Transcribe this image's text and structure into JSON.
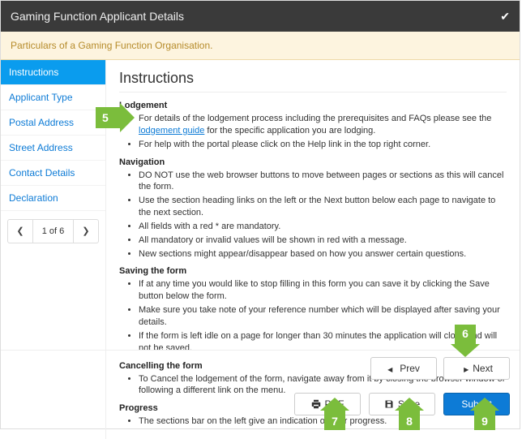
{
  "header": {
    "title": "Gaming Function Applicant Details"
  },
  "notice": "Particulars of a Gaming Function Organisation.",
  "sidebar": {
    "items": [
      "Instructions",
      "Applicant Type",
      "Postal Address",
      "Street Address",
      "Contact Details",
      "Declaration"
    ],
    "active_index": 0,
    "pager": "1 of 6"
  },
  "main": {
    "title": "Instructions",
    "sections": [
      {
        "heading": "Lodgement",
        "items": [
          {
            "pre": "For details of the lodgement process including the prerequisites and FAQs please see the ",
            "link": "lodgement guide",
            "post": " for the specific application you are lodging."
          },
          {
            "text": "For help with the portal please click on the Help link in the top right corner."
          }
        ]
      },
      {
        "heading": "Navigation",
        "items": [
          {
            "text": "DO NOT use the web browser buttons to move between pages or sections as this will cancel the form."
          },
          {
            "text": "Use the section heading links on the left or the Next button below each page to navigate to the next section."
          },
          {
            "text": "All fields with a red * are mandatory."
          },
          {
            "text": "All mandatory or invalid values will be shown in red with a message."
          },
          {
            "text": "New sections might appear/disappear based on how you answer certain questions."
          }
        ]
      },
      {
        "heading": "Saving the form",
        "items": [
          {
            "text": "If at any time you would like to stop filling in this form you can save it by clicking the Save button below the form."
          },
          {
            "text": "Make sure you take note of your reference number which will be displayed after saving your details."
          },
          {
            "text": "If the form is left idle on a page for longer than 30 minutes the application will close and will not be saved."
          }
        ]
      },
      {
        "heading": "Cancelling the form",
        "items": [
          {
            "text": "To Cancel the lodgement of the form, navigate away from it by closing the browser window or following a different link on the menu."
          }
        ]
      },
      {
        "heading": "Progress",
        "items": [
          {
            "text": "The sections bar on the left give an indication of your progress."
          }
        ]
      }
    ]
  },
  "footer": {
    "prev": "Prev",
    "next": "Next",
    "pdf": "PDF",
    "save": "Save",
    "submit": "Submit"
  },
  "callouts": {
    "c5": "5",
    "c6": "6",
    "c7": "7",
    "c8": "8",
    "c9": "9"
  }
}
